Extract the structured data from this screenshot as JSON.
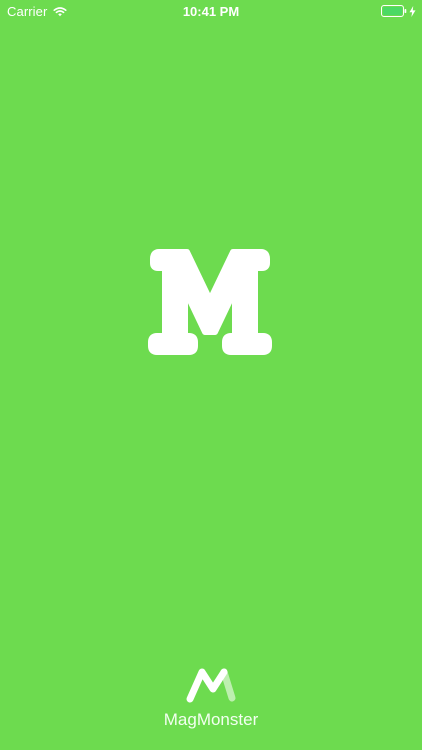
{
  "status_bar": {
    "carrier": "Carrier",
    "time": "10:41 PM",
    "wifi_icon": "wifi-icon",
    "battery_icon": "battery-icon",
    "charging_icon": "charging-bolt-icon"
  },
  "splash": {
    "logo_icon": "monogram-m-logo",
    "app_name": "MagMonster",
    "brand_icon": "magmonster-mark-icon"
  },
  "colors": {
    "background": "#6ddb4f",
    "foreground": "#ffffff"
  }
}
